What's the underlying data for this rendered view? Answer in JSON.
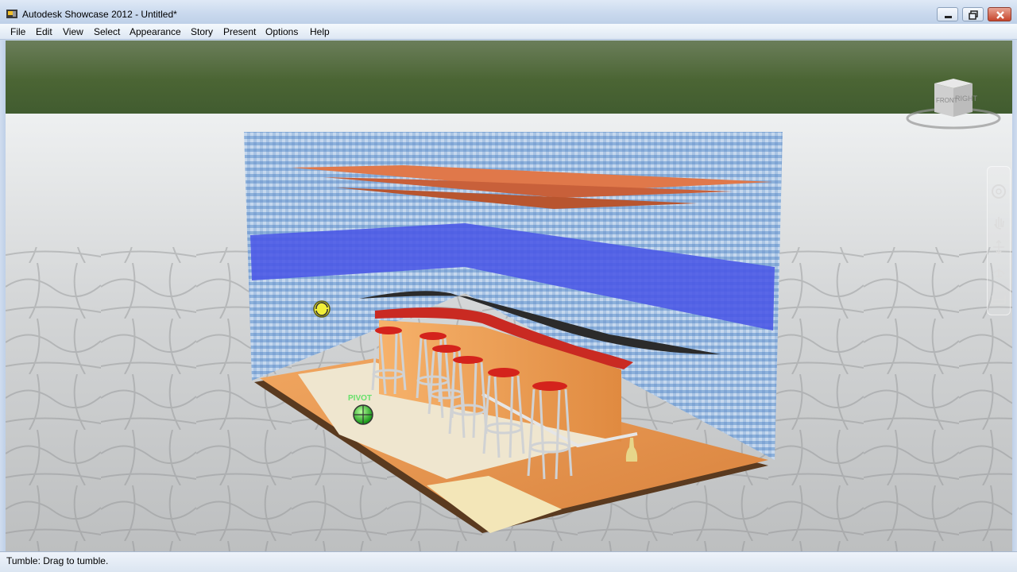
{
  "window": {
    "title": "Autodesk Showcase 2012 - Untitled*"
  },
  "menu": {
    "items": [
      "File",
      "Edit",
      "View",
      "Select",
      "Appearance",
      "Story",
      "Present",
      "Options",
      "Help"
    ]
  },
  "viewcube": {
    "faces": [
      "FRONT",
      "RIGHT"
    ]
  },
  "scene": {
    "pivot_label": "PIVOT",
    "colors": {
      "sky_foliage": "#4f6a3a",
      "salt_flat": "#d9dbdc",
      "tile_wall": "#8fb3dc",
      "water_band": "#4a57e6",
      "ceiling_panel": "#e0784a",
      "bar_top": "#c92a22",
      "wood": "#e4964e",
      "floor_cream": "#efe6cf"
    }
  },
  "navbar": {
    "tools": [
      "steering-wheel-icon",
      "pan-icon",
      "zoom-icon",
      "orbit-icon",
      "look-icon"
    ]
  },
  "status": {
    "text": "Tumble: Drag to tumble."
  }
}
